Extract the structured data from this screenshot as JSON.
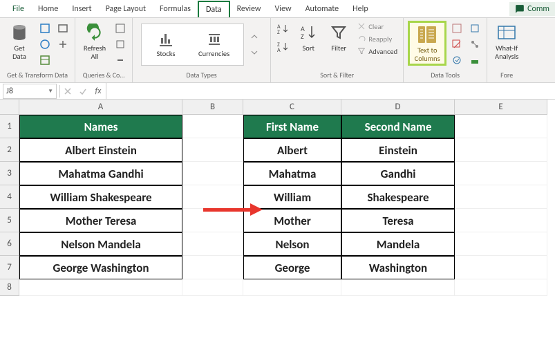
{
  "tabs": [
    "File",
    "Home",
    "Insert",
    "Page Layout",
    "Formulas",
    "Data",
    "Review",
    "View",
    "Automate",
    "Help"
  ],
  "activeTab": "Data",
  "share": "Comm",
  "ribbon": {
    "getData": "Get\nData",
    "getDataGroup": "Get & Transform Data",
    "refreshAll": "Refresh\nAll",
    "queriesGroup": "Queries & Co…",
    "stocks": "Stocks",
    "currencies": "Currencies",
    "dataTypesGroup": "Data Types",
    "sort": "Sort",
    "filter": "Filter",
    "clear": "Clear",
    "reapply": "Reapply",
    "advanced": "Advanced",
    "sortFilterGroup": "Sort & Filter",
    "textToColumns": "Text to\nColumns",
    "dataToolsGroup": "Data Tools",
    "whatIf": "What-If\nAnalysis",
    "forecastGroup": "Fore"
  },
  "nameBox": "J8",
  "colHeaders": [
    "A",
    "B",
    "C",
    "D",
    "E"
  ],
  "rowNums": [
    "1",
    "2",
    "3",
    "4",
    "5",
    "6",
    "7",
    "8"
  ],
  "headers": {
    "names": "Names",
    "first": "First Name",
    "second": "Second Name"
  },
  "rows": [
    {
      "full": "Albert Einstein",
      "first": "Albert",
      "second": "Einstein"
    },
    {
      "full": "Mahatma Gandhi",
      "first": "Mahatma",
      "second": "Gandhi"
    },
    {
      "full": "William Shakespeare",
      "first": "William",
      "second": "Shakespeare"
    },
    {
      "full": "Mother Teresa",
      "first": "Mother",
      "second": "Teresa"
    },
    {
      "full": "Nelson Mandela",
      "first": "Nelson",
      "second": "Mandela"
    },
    {
      "full": "George Washington",
      "first": "George",
      "second": "Washington"
    }
  ]
}
